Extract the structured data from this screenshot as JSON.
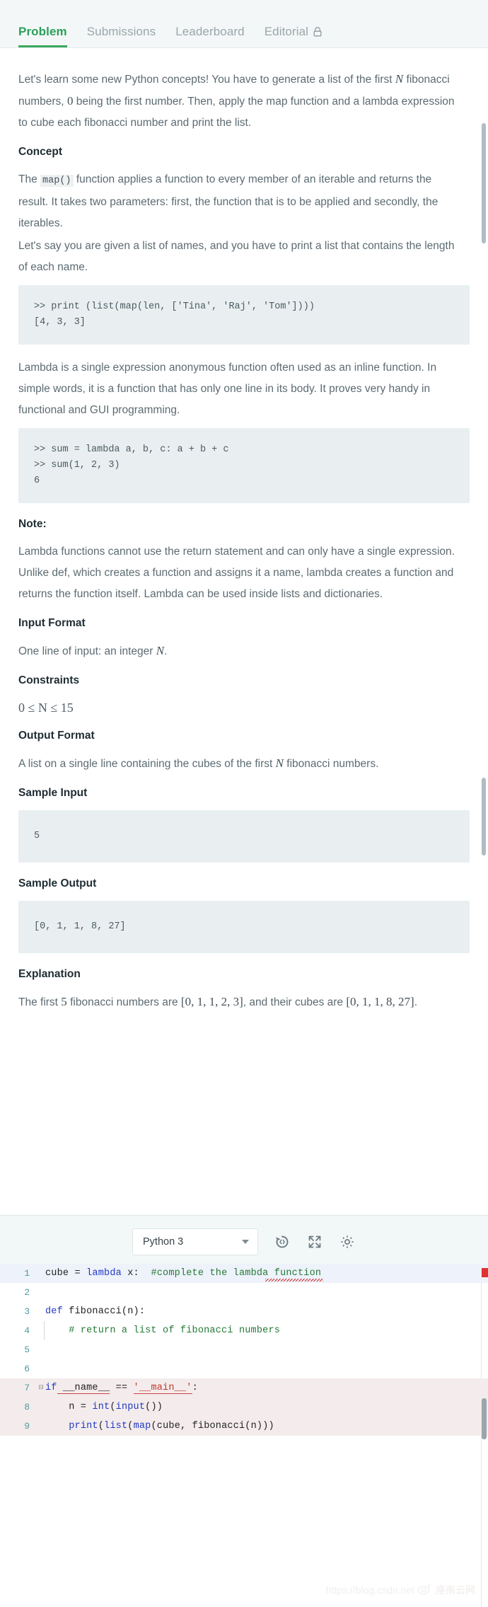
{
  "tabs": [
    {
      "label": "Problem",
      "active": true,
      "locked": false
    },
    {
      "label": "Submissions",
      "active": false,
      "locked": false
    },
    {
      "label": "Leaderboard",
      "active": false,
      "locked": false
    },
    {
      "label": "Editorial",
      "active": false,
      "locked": true
    }
  ],
  "problem": {
    "intro_1": "Let's learn some new Python concepts! You have to generate a list of the first",
    "intro_var_n": "N",
    "intro_2": "fibonacci numbers,",
    "intro_zero": "0",
    "intro_3": "being the first number. Then, apply the map function and a lambda expression to cube each fibonacci number and print the list.",
    "concept_heading": "Concept",
    "concept_p1_a": "The",
    "concept_p1_code": "map()",
    "concept_p1_b": "function applies a function to every member of an iterable and returns the result. It takes two parameters: first, the function that is to be applied and secondly, the iterables.",
    "concept_p2": "Let's say you are given a list of names, and you have to print a list that contains the length of each name.",
    "code_map": ">> print (list(map(len, ['Tina', 'Raj', 'Tom'])))\n[4, 3, 3]",
    "lambda_p": "Lambda is a single expression anonymous function often used as an inline function. In simple words, it is a function that has only one line in its body. It proves very handy in functional and GUI programming.",
    "code_lambda": ">> sum = lambda a, b, c: a + b + c\n>> sum(1, 2, 3)\n6",
    "note_heading": "Note:",
    "note_p": "Lambda functions cannot use the return statement and can only have a single expression. Unlike def, which creates a function and assigns it a name, lambda creates a function and returns the function itself. Lambda can be used inside lists and dictionaries.",
    "input_format_heading": "Input Format",
    "input_format_a": "One line of input: an integer",
    "input_format_var": "N",
    "input_format_b": ".",
    "constraints_heading": "Constraints",
    "constraints_expr": "0 ≤ N ≤ 15",
    "output_format_heading": "Output Format",
    "output_format_a": "A list on a single line containing the cubes of the first",
    "output_format_var": "N",
    "output_format_b": "fibonacci numbers.",
    "sample_input_heading": "Sample Input",
    "sample_input_code": "5",
    "sample_output_heading": "Sample Output",
    "sample_output_code": "[0, 1, 1, 8, 27]",
    "explanation_heading": "Explanation",
    "explanation_a": "The first",
    "explanation_count": "5",
    "explanation_b": "fibonacci numbers are",
    "explanation_list1": "[0, 1, 1, 2, 3]",
    "explanation_c": ", and their cubes are",
    "explanation_list2": "[0, 1, 1, 8, 27]",
    "explanation_d": "."
  },
  "editor": {
    "language": "Python 3",
    "icons": {
      "restore": "restore-code-icon",
      "fullscreen": "fullscreen-icon",
      "settings": "gear-icon"
    },
    "lines": [
      {
        "num": "1",
        "state": "active",
        "fold": "",
        "indent": false,
        "segments": [
          {
            "t": "cube ",
            "c": "plain"
          },
          {
            "t": "= ",
            "c": "plain"
          },
          {
            "t": "lambda",
            "c": "kw"
          },
          {
            "t": " x:  ",
            "c": "plain"
          },
          {
            "t": "#complete the lambda function",
            "c": "cm"
          }
        ]
      },
      {
        "num": "2",
        "state": "normal",
        "fold": "",
        "indent": false,
        "segments": []
      },
      {
        "num": "3",
        "state": "normal",
        "fold": "",
        "indent": false,
        "segments": [
          {
            "t": "def",
            "c": "kw"
          },
          {
            "t": " fibonacci(n):",
            "c": "plain"
          }
        ]
      },
      {
        "num": "4",
        "state": "normal",
        "fold": "",
        "indent": true,
        "segments": [
          {
            "t": "    # return a list of fibonacci numbers",
            "c": "cm"
          }
        ]
      },
      {
        "num": "5",
        "state": "normal",
        "fold": "",
        "indent": false,
        "segments": []
      },
      {
        "num": "6",
        "state": "normal",
        "fold": "",
        "indent": false,
        "segments": []
      },
      {
        "num": "7",
        "state": "locked",
        "fold": "⊟",
        "indent": false,
        "segments": [
          {
            "t": "if",
            "c": "kw"
          },
          {
            "t": " __name__",
            "c": "err-under"
          },
          {
            "t": " == ",
            "c": "plain"
          },
          {
            "t": "'__main__'",
            "c": "err-str"
          },
          {
            "t": ":",
            "c": "plain"
          }
        ]
      },
      {
        "num": "8",
        "state": "locked",
        "fold": "",
        "indent": false,
        "segments": [
          {
            "t": "    n = ",
            "c": "plain"
          },
          {
            "t": "int",
            "c": "fn"
          },
          {
            "t": "(",
            "c": "plain"
          },
          {
            "t": "input",
            "c": "fn"
          },
          {
            "t": "())",
            "c": "plain"
          }
        ]
      },
      {
        "num": "9",
        "state": "locked",
        "fold": "",
        "indent": false,
        "segments": [
          {
            "t": "    ",
            "c": "plain"
          },
          {
            "t": "print",
            "c": "fn"
          },
          {
            "t": "(",
            "c": "plain"
          },
          {
            "t": "list",
            "c": "fn"
          },
          {
            "t": "(",
            "c": "plain"
          },
          {
            "t": "map",
            "c": "fn"
          },
          {
            "t": "(cube, fibonacci(n)))",
            "c": "plain"
          }
        ]
      }
    ]
  },
  "watermark": {
    "url": "https://blog.csdn.net",
    "cn": "座南云网"
  },
  "colors": {
    "accent_green": "#39a85f",
    "tab_inactive": "#9aa6ab",
    "body_text": "#5c6b72",
    "code_bg": "#e9eff0",
    "editor_bg": "#f2f7f7",
    "locked_line_bg": "#f4ecec",
    "active_line_bg": "#eef2fa",
    "error_red": "#cc4040"
  }
}
